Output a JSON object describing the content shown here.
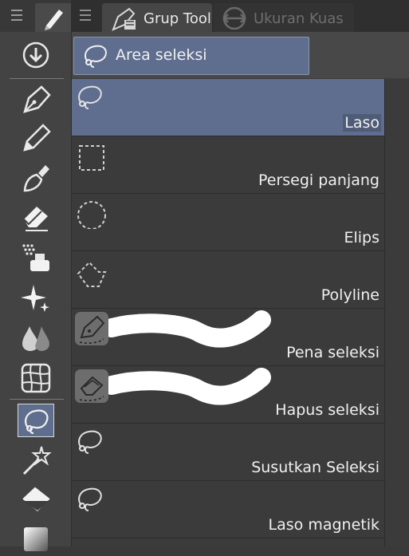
{
  "toolbar": {
    "menu_icon": "hamburger-menu-icon",
    "active_tool_icon": "pencil-icon",
    "tools": [
      {
        "name": "sub-view-icon"
      },
      {
        "name": "pen-nib-icon"
      },
      {
        "name": "pencil-icon"
      },
      {
        "name": "brush-icon"
      },
      {
        "name": "eraser-icon"
      },
      {
        "name": "airbrush-icon"
      },
      {
        "name": "sparkle-icon"
      },
      {
        "name": "blend-drops-icon"
      },
      {
        "name": "grid-warp-icon"
      },
      {
        "name": "lasso-selection-icon"
      },
      {
        "name": "magic-wand-icon"
      },
      {
        "name": "fill-bucket-icon"
      },
      {
        "name": "gradient-icon"
      }
    ],
    "active_index": 9
  },
  "panel": {
    "menu_icon": "hamburger-menu-icon",
    "tabs": [
      {
        "label": "Grup Tool",
        "icon": "tool-group-icon",
        "active": true
      },
      {
        "label": "Ukuran Kuas",
        "icon": "brush-size-icon",
        "active": false
      }
    ],
    "group": {
      "label": "Area seleksi",
      "icon": "lasso-icon"
    },
    "tools": [
      {
        "label": "Laso",
        "icon": "lasso-icon",
        "selected": true
      },
      {
        "label": "Persegi panjang",
        "icon": "rectangle-marquee-icon",
        "selected": false
      },
      {
        "label": "Elips",
        "icon": "ellipse-marquee-icon",
        "selected": false
      },
      {
        "label": "Polyline",
        "icon": "polyline-marquee-icon",
        "selected": false
      },
      {
        "label": "Pena seleksi",
        "icon": "selection-pen-icon",
        "selected": false
      },
      {
        "label": "Hapus seleksi",
        "icon": "selection-eraser-icon",
        "selected": false
      },
      {
        "label": "Susutkan Seleksi",
        "icon": "lasso-icon",
        "selected": false
      },
      {
        "label": "Laso magnetik",
        "icon": "lasso-icon",
        "selected": false
      }
    ]
  },
  "colors": {
    "selected_bg": "#5f6e8e",
    "panel_bg": "#3b3b3b",
    "toolbar_bg": "#434343",
    "text": "#f0f0f0"
  }
}
